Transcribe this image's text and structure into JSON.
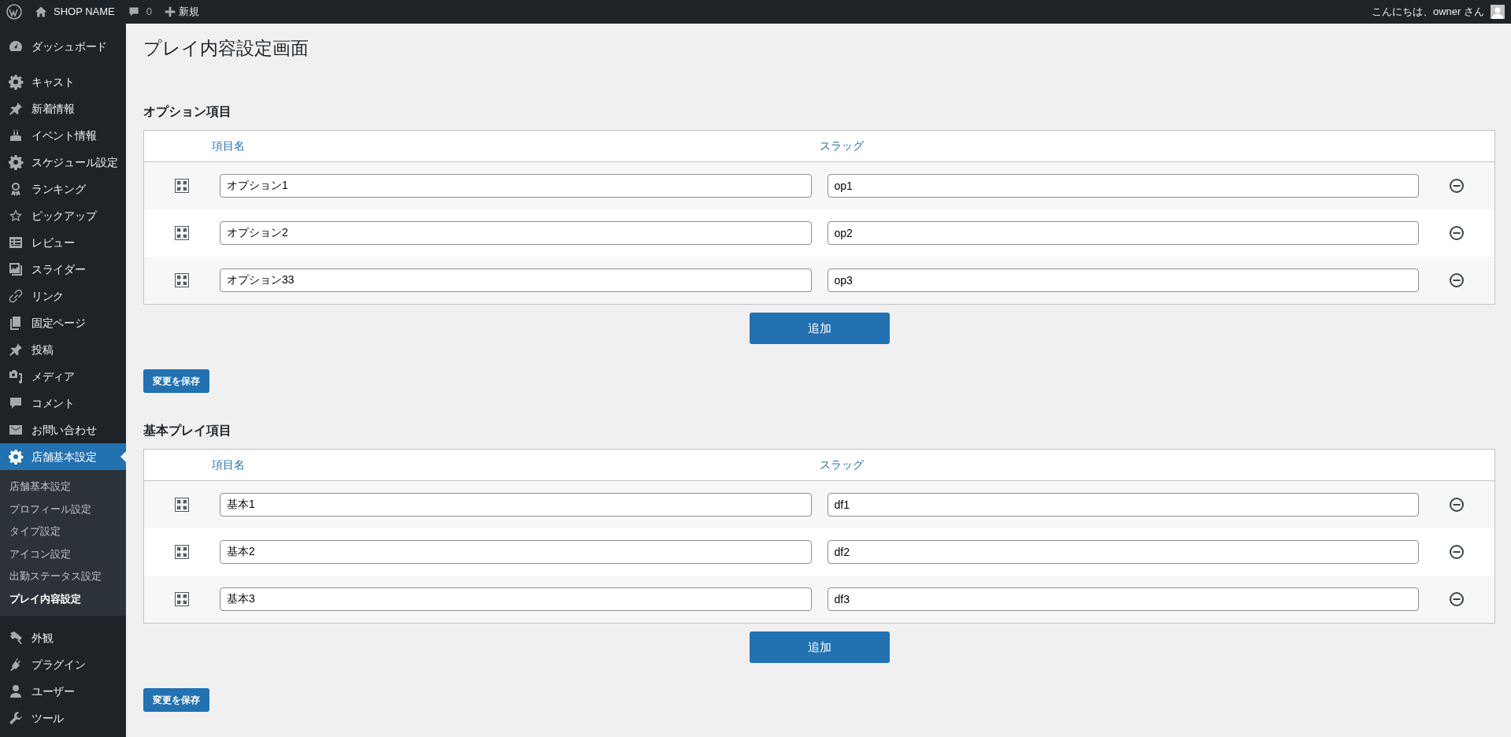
{
  "admin_bar": {
    "site_name": "SHOP NAME",
    "comment_count": "0",
    "new_label": "新規",
    "greeting": "こんにちは、owner さん"
  },
  "sidebar": {
    "items": [
      {
        "label": "ダッシュボード",
        "selected": false
      },
      {
        "label": "キャスト",
        "selected": false
      },
      {
        "label": "新着情報",
        "selected": false
      },
      {
        "label": "イベント情報",
        "selected": false
      },
      {
        "label": "スケジュール設定",
        "selected": false
      },
      {
        "label": "ランキング",
        "selected": false
      },
      {
        "label": "ピックアップ",
        "selected": false
      },
      {
        "label": "レビュー",
        "selected": false
      },
      {
        "label": "スライダー",
        "selected": false
      },
      {
        "label": "リンク",
        "selected": false
      },
      {
        "label": "固定ページ",
        "selected": false
      },
      {
        "label": "投稿",
        "selected": false
      },
      {
        "label": "メディア",
        "selected": false
      },
      {
        "label": "コメント",
        "selected": false
      },
      {
        "label": "お問い合わせ",
        "selected": false
      },
      {
        "label": "店舗基本設定",
        "selected": true,
        "children": [
          {
            "label": "店舗基本設定",
            "selected": false
          },
          {
            "label": "プロフィール設定",
            "selected": false
          },
          {
            "label": "タイプ設定",
            "selected": false
          },
          {
            "label": "アイコン設定",
            "selected": false
          },
          {
            "label": "出勤ステータス設定",
            "selected": false
          },
          {
            "label": "プレイ内容設定",
            "selected": true
          }
        ]
      },
      {
        "label": "外観",
        "selected": false
      },
      {
        "label": "プラグイン",
        "selected": false
      },
      {
        "label": "ユーザー",
        "selected": false
      },
      {
        "label": "ツール",
        "selected": false
      }
    ]
  },
  "page_title": "プレイ内容設定画面",
  "sections": [
    {
      "heading": "オプション項目",
      "columns": [
        "項目名",
        "スラッグ"
      ],
      "rows": [
        {
          "name": "オプション1",
          "slug": "op1"
        },
        {
          "name": "オプション2",
          "slug": "op2"
        },
        {
          "name": "オプション33",
          "slug": "op3"
        }
      ],
      "add_button": "追加",
      "save_button": "変更を保存"
    },
    {
      "heading": "基本プレイ項目",
      "columns": [
        "項目名",
        "スラッグ"
      ],
      "rows": [
        {
          "name": "基本1",
          "slug": "df1"
        },
        {
          "name": "基本2",
          "slug": "df2"
        },
        {
          "name": "基本3",
          "slug": "df3"
        }
      ],
      "add_button": "追加",
      "save_button": "変更を保存"
    }
  ]
}
